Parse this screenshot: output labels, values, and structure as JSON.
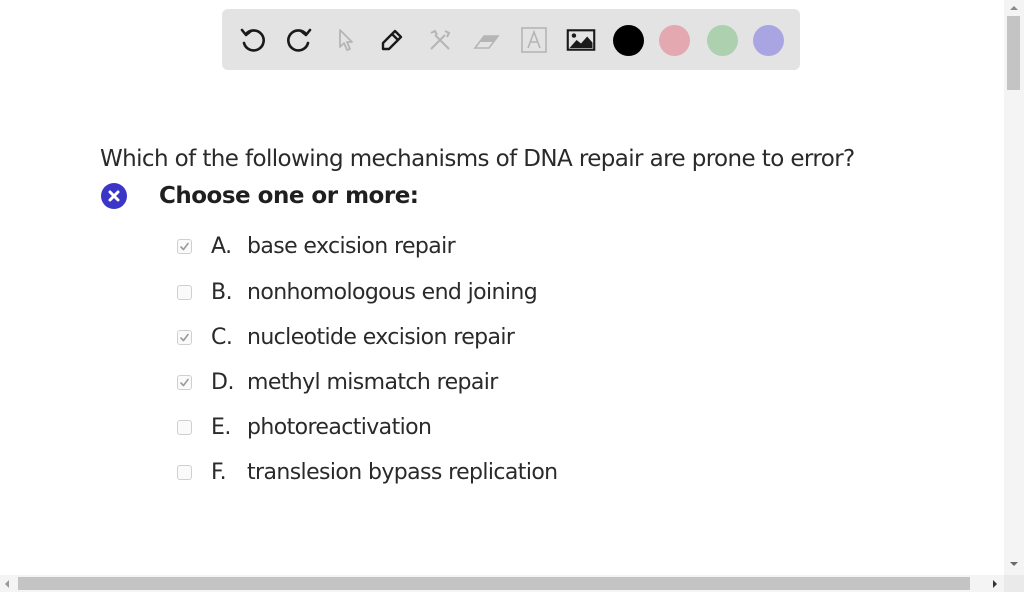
{
  "toolbar": {
    "tools": [
      {
        "name": "undo",
        "icon": "undo-icon",
        "enabled": true
      },
      {
        "name": "redo",
        "icon": "redo-icon",
        "enabled": true
      },
      {
        "name": "select",
        "icon": "pointer-icon",
        "enabled": false
      },
      {
        "name": "pen",
        "icon": "pencil-icon",
        "enabled": true
      },
      {
        "name": "tools",
        "icon": "crossed-tools-icon",
        "enabled": false
      },
      {
        "name": "eraser",
        "icon": "eraser-icon",
        "enabled": false
      },
      {
        "name": "text",
        "icon": "text-box-icon",
        "enabled": false
      },
      {
        "name": "image",
        "icon": "image-icon",
        "enabled": true
      }
    ],
    "colors": [
      {
        "name": "black",
        "hex": "#000000",
        "selected": true
      },
      {
        "name": "pink",
        "hex": "#e3a8b0",
        "selected": false
      },
      {
        "name": "green",
        "hex": "#add0ae",
        "selected": false
      },
      {
        "name": "purple",
        "hex": "#a9a5e3",
        "selected": false
      }
    ]
  },
  "question": {
    "text": "Which of the following mechanisms of DNA repair are prone to error?",
    "status_icon": "incorrect-x-icon",
    "status_color": "#3b36c8",
    "instruction": "Choose one or more:",
    "options": [
      {
        "letter": "A.",
        "text": "base excision repair",
        "checked": true
      },
      {
        "letter": "B.",
        "text": "nonhomologous end joining",
        "checked": false
      },
      {
        "letter": "C.",
        "text": "nucleotide excision repair",
        "checked": true
      },
      {
        "letter": "D.",
        "text": "methyl mismatch repair",
        "checked": true
      },
      {
        "letter": "E.",
        "text": "photoreactivation",
        "checked": false
      },
      {
        "letter": "F.",
        "text": "translesion bypass replication",
        "checked": false
      }
    ]
  }
}
